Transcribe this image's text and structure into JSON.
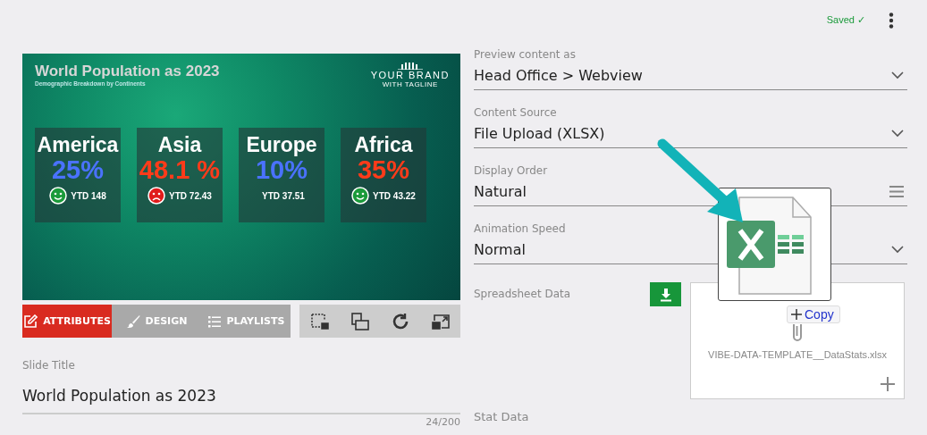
{
  "header": {
    "save_status": "Saved ✓"
  },
  "slide": {
    "title": "World Population as 2023",
    "subtitle": "Demographic Breakdown by Continents",
    "brand": "YOUR BRAND",
    "tagline": "WITH TAGLINE",
    "stats": [
      {
        "region": "America",
        "value": "25%",
        "color": "#4a72ff",
        "kind": "happy",
        "ytd": "YTD 148"
      },
      {
        "region": "Asia",
        "value": "48.1 %",
        "color": "#ff3b1a",
        "kind": "sad",
        "ytd": "YTD 72.43"
      },
      {
        "region": "Europe",
        "value": "10%",
        "color": "#4a72ff",
        "kind": "plain",
        "ytd": "YTD 37.51"
      },
      {
        "region": "Africa",
        "value": "35%",
        "color": "#ff3b1a",
        "kind": "happy",
        "ytd": "YTD 43.22"
      }
    ]
  },
  "tabs": [
    {
      "label": "ATTRIBUTES",
      "selected": true
    },
    {
      "label": "DESIGN",
      "selected": false
    },
    {
      "label": "PLAYLISTS",
      "selected": false
    }
  ],
  "slide_title_field": {
    "label": "Slide Title",
    "value": "World Population as 2023",
    "counter": "24/200"
  },
  "settings": [
    {
      "label": "Preview content as",
      "value": "Head Office > Webview",
      "kind": "dropdown"
    },
    {
      "label": "Content Source",
      "value": "File Upload (XLSX)",
      "kind": "dropdown"
    },
    {
      "label": "Display Order",
      "value": "Natural",
      "kind": "order"
    },
    {
      "label": "Animation Speed",
      "value": "Normal",
      "kind": "dropdown"
    }
  ],
  "spreadsheet": {
    "label": "Spreadsheet Data",
    "file_name": "VIBE-DATA-TEMPLATE__DataStats.xlsx"
  },
  "drag": {
    "tooltip": "Copy"
  },
  "stat_data": {
    "label": "Stat Data"
  }
}
